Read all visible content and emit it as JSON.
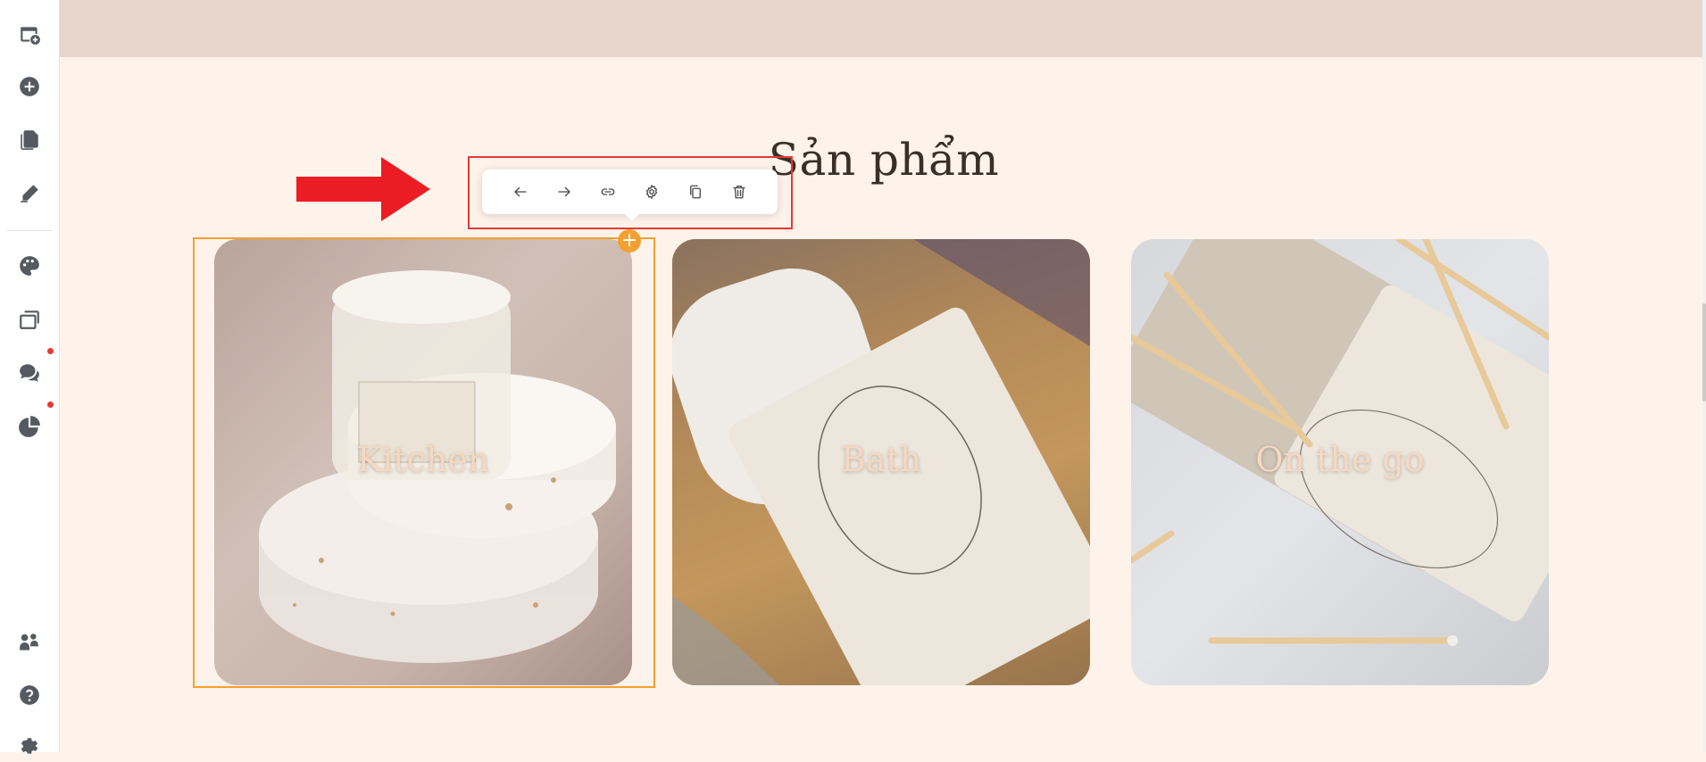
{
  "sidebar": {
    "items": [
      {
        "name": "add-page-icon"
      },
      {
        "name": "add-element-icon"
      },
      {
        "name": "pages-icon"
      },
      {
        "name": "pen-icon"
      },
      {
        "name": "palette-icon"
      },
      {
        "name": "layers-icon"
      },
      {
        "name": "chat-icon"
      },
      {
        "name": "analytics-icon"
      },
      {
        "name": "apps-icon"
      },
      {
        "name": "help-icon"
      },
      {
        "name": "settings-icon"
      }
    ]
  },
  "section": {
    "title": "Sản phẩm"
  },
  "toolbar": {
    "buttons": [
      "move-left-icon",
      "move-right-icon",
      "link-icon",
      "settings-icon",
      "duplicate-icon",
      "delete-icon"
    ]
  },
  "cards": [
    {
      "label": "Kitchen"
    },
    {
      "label": "Bath"
    },
    {
      "label": "On the go"
    }
  ],
  "selection": {
    "add_symbol": "+"
  },
  "colors": {
    "accent": "#f5a030",
    "annotation": "#e53935",
    "banner": "#e8d6cd",
    "canvas": "#fdf3ea"
  }
}
